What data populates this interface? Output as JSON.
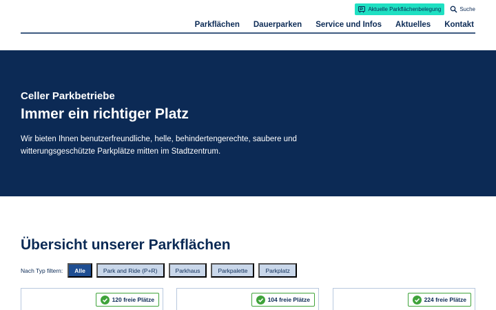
{
  "header": {
    "live_button": "Aktuelle Parkflächenbelegung",
    "search_label": "Suche",
    "nav": [
      "Parkflächen",
      "Dauerparken",
      "Service und Infos",
      "Aktuelles",
      "Kontakt"
    ]
  },
  "hero": {
    "kicker": "Celler Parkbetriebe",
    "title": "Immer ein richtiger Platz",
    "text": "Wir bieten Ihnen benutzerfreundliche, helle, behindertengerechte, saubere und witterungsgeschützte Parkplätze mitten im Stadtzentrum."
  },
  "overview": {
    "title": "Übersicht unserer Parkflächen",
    "filter_label": "Nach Typ filtern:",
    "filters": [
      "Alle",
      "Park and Ride (P+R)",
      "Parkhaus",
      "Parkpalette",
      "Parkplatz"
    ],
    "active_filter": "Alle",
    "cards": [
      {
        "free": "120 freie Plätze"
      },
      {
        "free": "104 freie Plätze"
      },
      {
        "free": "224 freie Plätze"
      }
    ]
  },
  "colors": {
    "navy": "#0c2a55",
    "accent_teal": "#1fe0c2",
    "filter_active": "#1f4e92",
    "filter_inactive": "#c9d7ea",
    "badge_green": "#3fa33a"
  },
  "icons": {
    "live_button": "parking-occupancy-icon",
    "search": "search-icon",
    "badge": "check-circle-icon"
  }
}
